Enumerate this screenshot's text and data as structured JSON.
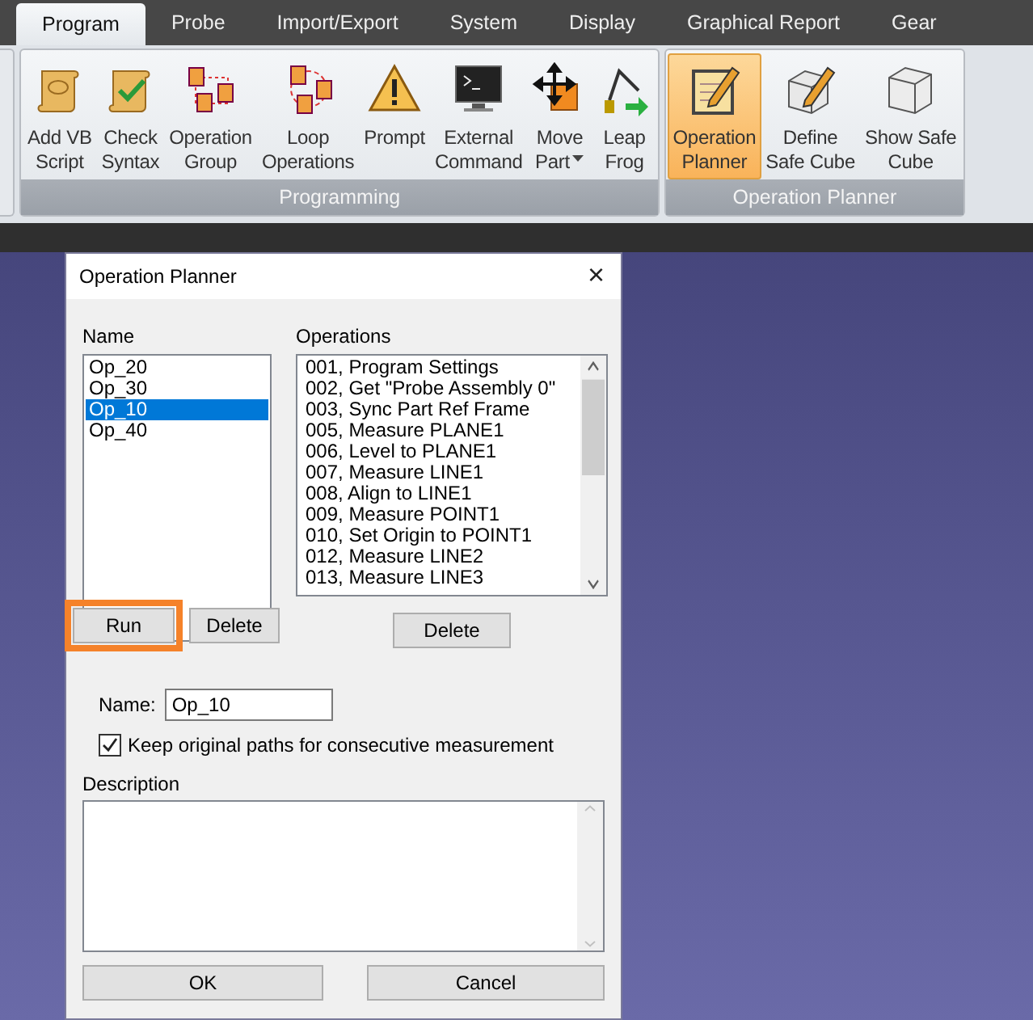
{
  "menu_tabs": [
    {
      "label": "Program",
      "selected": true
    },
    {
      "label": "Probe",
      "selected": false
    },
    {
      "label": "Import/Export",
      "selected": false
    },
    {
      "label": "System",
      "selected": false
    },
    {
      "label": "Display",
      "selected": false
    },
    {
      "label": "Graphical Report",
      "selected": false
    },
    {
      "label": "Gear",
      "selected": false
    }
  ],
  "ribbon_groups": [
    {
      "title": "Programming",
      "buttons": [
        {
          "lines": [
            "Add VB",
            "Script"
          ],
          "selected": false,
          "dropdown": false
        },
        {
          "lines": [
            "Check",
            "Syntax"
          ],
          "selected": false,
          "dropdown": false
        },
        {
          "lines": [
            "Operation",
            "Group"
          ],
          "selected": false,
          "dropdown": false
        },
        {
          "lines": [
            "Loop",
            "Operations"
          ],
          "selected": false,
          "dropdown": false
        },
        {
          "lines": [
            "Prompt"
          ],
          "selected": false,
          "dropdown": false
        },
        {
          "lines": [
            "External",
            "Command"
          ],
          "selected": false,
          "dropdown": false
        },
        {
          "lines": [
            "Move",
            "Part"
          ],
          "selected": false,
          "dropdown": true
        },
        {
          "lines": [
            "Leap",
            "Frog"
          ],
          "selected": false,
          "dropdown": false
        }
      ]
    },
    {
      "title": "Operation Planner",
      "buttons": [
        {
          "lines": [
            "Operation",
            "Planner"
          ],
          "selected": true,
          "dropdown": false
        },
        {
          "lines": [
            "Define",
            "Safe Cube"
          ],
          "selected": false,
          "dropdown": false
        },
        {
          "lines": [
            "Show Safe",
            "Cube"
          ],
          "selected": false,
          "dropdown": false
        }
      ]
    }
  ],
  "dialog": {
    "title": "Operation Planner",
    "close": "×",
    "names": {
      "label": "Name",
      "items": [
        {
          "text": "Op_20",
          "selected": false
        },
        {
          "text": "Op_30",
          "selected": false
        },
        {
          "text": "Op_10",
          "selected": true
        },
        {
          "text": "Op_40",
          "selected": false
        }
      ]
    },
    "operations": {
      "label": "Operations",
      "items": [
        "001, Program Settings",
        "002, Get \"Probe Assembly 0\"",
        "003, Sync Part Ref Frame",
        "005, Measure PLANE1",
        "006, Level to PLANE1",
        "007, Measure LINE1",
        "008, Align to LINE1",
        "009, Measure POINT1",
        "010, Set Origin to POINT1",
        "012, Measure LINE2",
        "013, Measure LINE3"
      ]
    },
    "run_button": {
      "label": "Run",
      "highlighted": true
    },
    "name_delete_button": "Delete",
    "operation_delete_button": "Delete",
    "name_field": {
      "label": "Name:",
      "value": "Op_10"
    },
    "keep_paths": {
      "label": "Keep original paths for consecutive measurement",
      "checked": true
    },
    "description": {
      "label": "Description"
    },
    "ok_button": "OK",
    "cancel_button": "Cancel"
  }
}
